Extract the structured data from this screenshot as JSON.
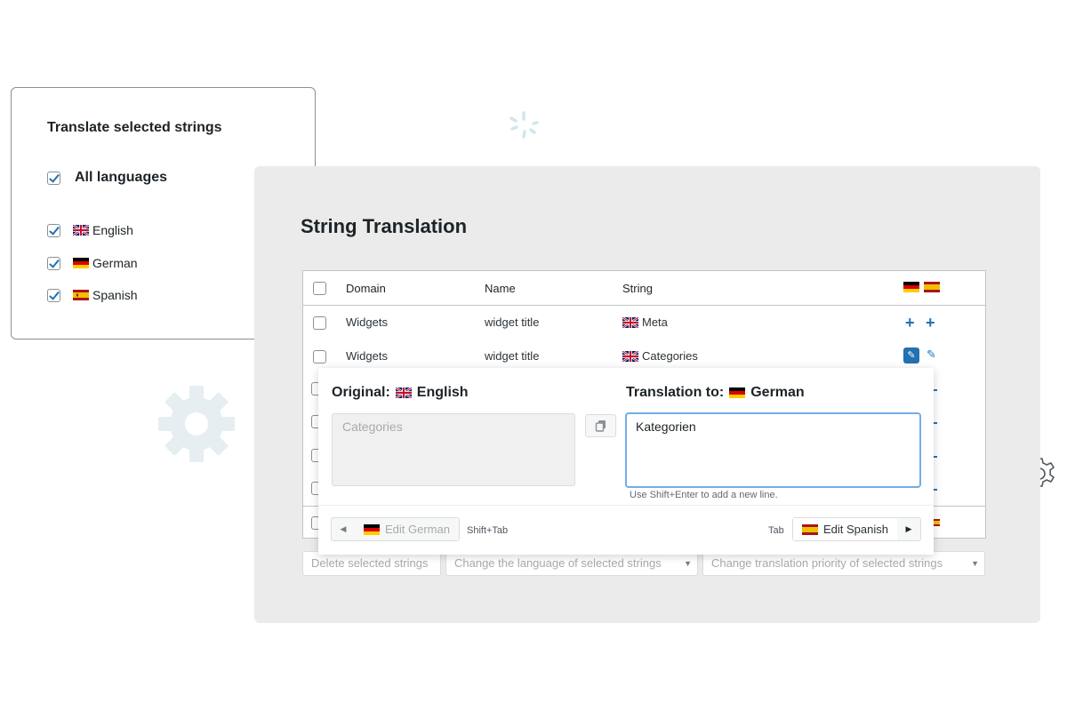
{
  "languages_panel": {
    "title": "Translate selected strings",
    "all_label": "All languages",
    "languages": [
      {
        "label": "English",
        "flag": "uk-flag-icon",
        "checked": true
      },
      {
        "label": "German",
        "flag": "germany-flag-icon",
        "checked": true
      },
      {
        "label": "Spanish",
        "flag": "spain-flag-icon",
        "checked": true
      }
    ]
  },
  "main": {
    "title": "String Translation",
    "table": {
      "headers": {
        "domain": "Domain",
        "name": "Name",
        "string": "String"
      },
      "rows": [
        {
          "domain": "Widgets",
          "name": "widget title",
          "string": "Meta",
          "status": "add"
        },
        {
          "domain": "Widgets",
          "name": "widget title",
          "string": "Categories",
          "status": "edit"
        }
      ]
    },
    "bulk_actions": {
      "delete": "Delete selected strings",
      "change_language": "Change the language of selected strings",
      "change_priority": "Change translation priority of selected strings"
    }
  },
  "editor": {
    "original_label": "Original:",
    "original_language": "English",
    "translation_label": "Translation to:",
    "translation_language": "German",
    "original_text": "Categories",
    "translation_text": "Kategorien",
    "hint": "Use Shift+Enter to add a new line.",
    "prev_button": "Edit German",
    "prev_key": "Shift+Tab",
    "next_key": "Tab",
    "next_button": "Edit Spanish"
  },
  "colors": {
    "accent": "#2271b1",
    "panel_bg": "#ebebeb",
    "focus": "#72aee6"
  }
}
